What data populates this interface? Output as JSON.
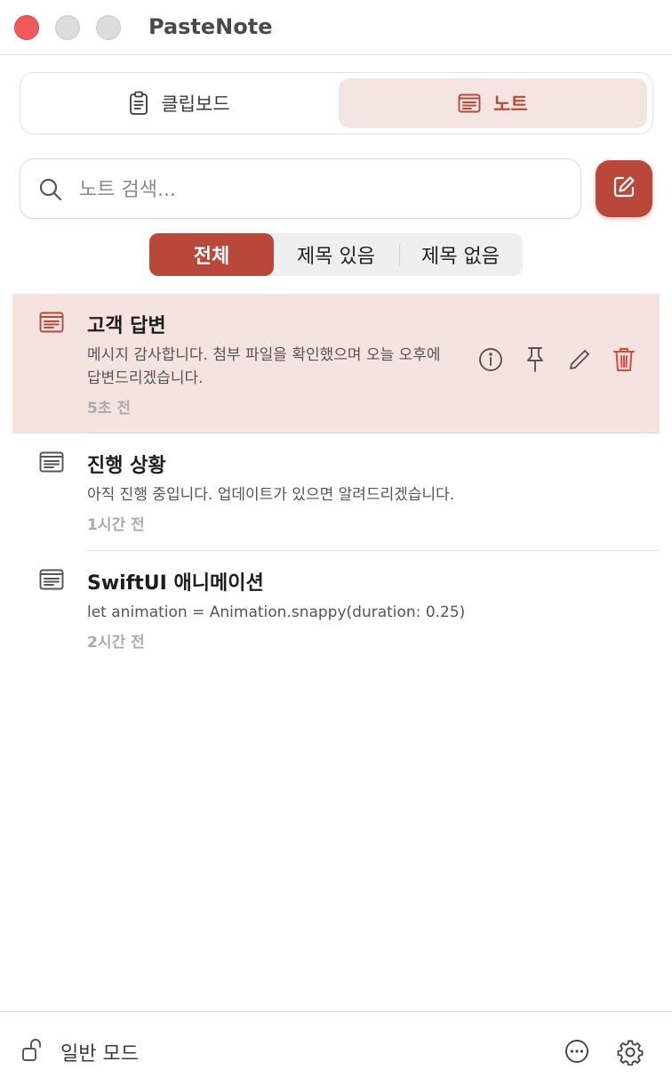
{
  "window": {
    "title": "PasteNote"
  },
  "tabs": {
    "clipboard": "클립보드",
    "notes": "노트"
  },
  "search": {
    "placeholder": "노트 검색..."
  },
  "filters": {
    "all": "전체",
    "titled": "제목 있음",
    "untitled": "제목 없음"
  },
  "notes": [
    {
      "title": "고객 답변",
      "body": "메시지 감사합니다. 첨부 파일을 확인했으며 오늘 오후에 답변드리겠습니다.",
      "time": "5초 전"
    },
    {
      "title": "진행 상황",
      "body": "아직 진행 중입니다. 업데이트가 있으면 알려드리겠습니다.",
      "time": "1시간 전"
    },
    {
      "title": "SwiftUI 애니메이션",
      "body": "let animation = Animation.snappy(duration: 0.25)",
      "time": "2시간 전"
    }
  ],
  "footer": {
    "mode_label": "일반 모드"
  },
  "colors": {
    "accent": "#b9473a",
    "selected_bg": "#f5e3e0",
    "delete": "#e0453a"
  },
  "icons": [
    "clipboard-icon",
    "note-icon",
    "search-icon",
    "compose-icon",
    "info-icon",
    "pin-icon",
    "pencil-icon",
    "trash-icon",
    "unlock-icon",
    "more-icon",
    "gear-icon"
  ]
}
